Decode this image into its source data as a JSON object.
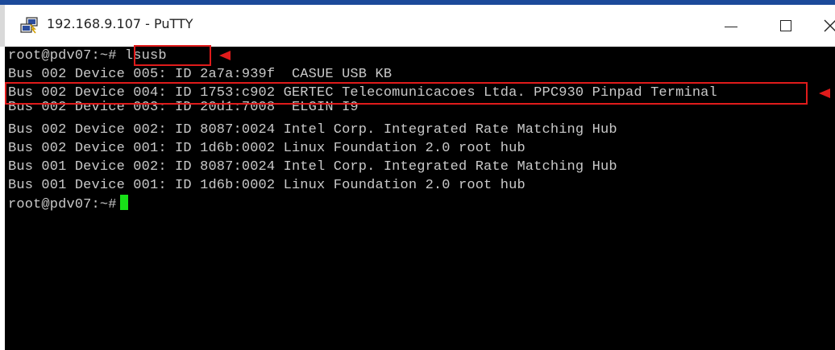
{
  "window": {
    "title": "192.168.9.107 - PuTTY",
    "icon": "putty-icon",
    "controls": {
      "minimize": "minimize-icon",
      "maximize": "maximize-icon",
      "close": "close-icon"
    }
  },
  "terminal": {
    "prompt_command": "root@pdv07:~# lsusb",
    "lines": [
      "Bus 002 Device 005: ID 2a7a:939f  CASUE USB KB",
      "Bus 002 Device 004: ID 1753:c902 GERTEC Telecomunicacoes Ltda. PPC930 Pinpad Terminal",
      "Bus 002 Device 003: ID 20d1:7008  ELGIN I9",
      "Bus 002 Device 002: ID 8087:0024 Intel Corp. Integrated Rate Matching Hub",
      "Bus 002 Device 001: ID 1d6b:0002 Linux Foundation 2.0 root hub",
      "Bus 001 Device 002: ID 8087:0024 Intel Corp. Integrated Rate Matching Hub",
      "Bus 001 Device 001: ID 1d6b:0002 Linux Foundation 2.0 root hub"
    ],
    "final_prompt": "root@pdv07:~#"
  },
  "colors": {
    "terminal_background": "#000000",
    "terminal_text": "#c9c9c9",
    "cursor": "#18e018",
    "annotation": "#e01b1b"
  }
}
